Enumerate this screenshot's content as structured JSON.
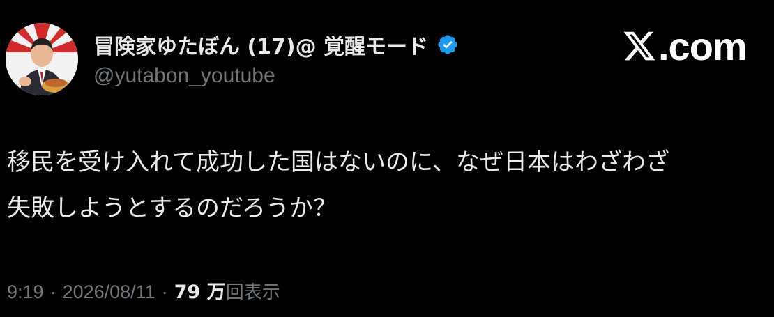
{
  "author": {
    "display_name": "冒険家ゆたぼん (17)@ 覚醒モード",
    "handle": "@yutabon_youtube",
    "verified": true
  },
  "brand": {
    "text": ".com"
  },
  "tweet": {
    "lines": [
      "移民を受け入れて成功した国はないのに、なぜ日本はわざわざ",
      "失敗しようとするのだろうか？"
    ]
  },
  "meta": {
    "time": "9:19",
    "separator": "·",
    "date": "2026/08/11",
    "views_count": "79 万",
    "views_label": "回表示"
  },
  "colors": {
    "background": "#000000",
    "text": "#e7e9ea",
    "secondary_text": "#71767b",
    "verified": "#1d9bf0"
  }
}
